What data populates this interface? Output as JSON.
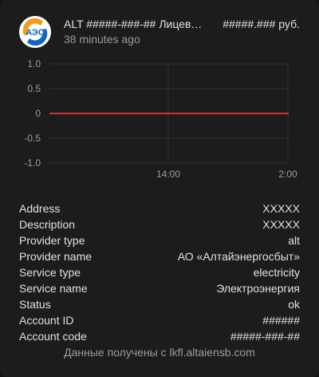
{
  "card": {
    "title": "ALT #####-###-## Лицевой счёт",
    "state": "#####.### руб.",
    "updated": "38 minutes ago",
    "avatar_icon": "aes-logo-icon",
    "colors": {
      "background": "#1c1c1c",
      "text": "#e1e1e1",
      "secondary_text": "#9b9b9b",
      "line": "#d32f2f",
      "logo_orange": "#f39c12",
      "logo_blue": "#1565c0"
    }
  },
  "chart_data": {
    "type": "line",
    "x_ticks": [
      "14:00",
      "2:00"
    ],
    "y_ticks": [
      "1.0",
      "0.5",
      "0",
      "-0.5",
      "-1.0"
    ],
    "ylim": [
      -1.0,
      1.0
    ],
    "grid": true,
    "series": [
      {
        "x": [
          "",
          ""
        ],
        "values": [
          0,
          0
        ]
      }
    ]
  },
  "attributes": [
    {
      "label": "Address",
      "value": "XXXXX"
    },
    {
      "label": "Description",
      "value": "XXXXX"
    },
    {
      "label": "Provider type",
      "value": "alt"
    },
    {
      "label": "Provider name",
      "value": "АО «Алтайэнергосбыт»"
    },
    {
      "label": "Service type",
      "value": "electricity"
    },
    {
      "label": "Service name",
      "value": "Электроэнергия"
    },
    {
      "label": "Status",
      "value": "ok"
    },
    {
      "label": "Account ID",
      "value": "######"
    },
    {
      "label": "Account code",
      "value": "#####-###-##"
    }
  ],
  "attribution": "Данные получены с lkfl.altaiensb.com"
}
